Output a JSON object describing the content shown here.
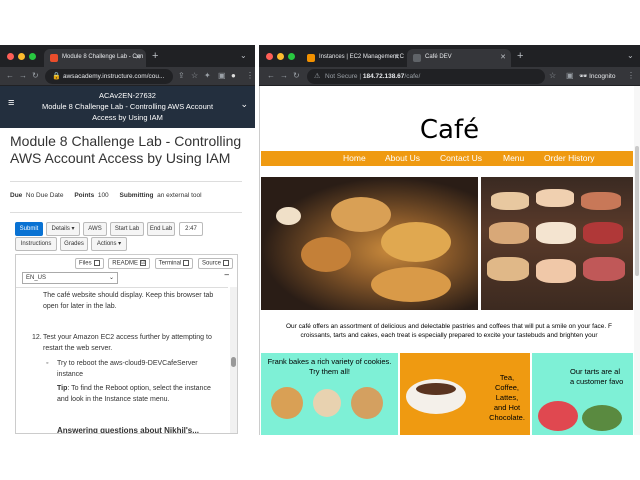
{
  "left_window": {
    "tab_title": "Module 8 Challenge Lab - Con",
    "url": "awsacademy.instructure.com/cou...",
    "header": {
      "course_code": "ACAv2EN-27632",
      "title_line1": "Module 8 Challenge Lab - Controlling AWS Account",
      "title_line2": "Access by Using IAM"
    },
    "page_title": "Module 8 Challenge Lab - Controlling AWS Account Access by Using IAM",
    "meta": {
      "due_label": "Due",
      "due_value": "No Due Date",
      "points_label": "Points",
      "points_value": "100",
      "submitting_label": "Submitting",
      "submitting_value": "an external tool"
    },
    "buttons": {
      "submit": "Submit",
      "details": "Details ▾",
      "aws": "AWS",
      "start_lab": "Start Lab",
      "end_lab": "End Lab",
      "timer": "2:47",
      "instructions": "Instructions",
      "grades": "Grades",
      "actions": "Actions ▾"
    },
    "toggles": {
      "files": "Files",
      "readme": "README",
      "terminal": "Terminal",
      "source": "Source",
      "readme_checked": "☑"
    },
    "language": "EN_US",
    "content": {
      "p1": "The café website should display. Keep this browser tab open for later in the lab.",
      "step_num": "12.",
      "step_text": "Test your Amazon EC2 access further by attempting to restart the web server.",
      "bullet_text": "Try to reboot the aws-cloud9-DEVCafeServer instance",
      "tip_bold": "Tip",
      "tip_text": ": To find the Reboot option, select the instance and look in the Instance state menu.",
      "next_heading": "Answering questions about Nikhil's..."
    }
  },
  "right_window": {
    "tabs": [
      {
        "title": "Instances | EC2 Management C"
      },
      {
        "title": "Café DEV"
      }
    ],
    "not_secure": "Not Secure",
    "url_host": "184.72.138.67",
    "url_path": "/cafe/",
    "incognito": "Incognito",
    "cafe": {
      "title": "Café",
      "menu": [
        "Home",
        "About Us",
        "Contact Us",
        "Menu",
        "Order History"
      ],
      "desc_line1": "Our café offers an assortment of delicious and delectable pastries and coffees that will put a smile on your face. F",
      "desc_line2": "croissants, tarts and cakes, each treat is especially prepared to excite your tastebuds and brighten your",
      "card1": "Frank bakes a rich variety of cookies. Try them all!",
      "card2_l1": "Tea,",
      "card2_l2": "Coffee,",
      "card2_l3": "Lattes,",
      "card2_l4": "and Hot",
      "card2_l5": "Chocolate.",
      "card3_l1": "Our tarts are al",
      "card3_l2": "a customer favo"
    }
  },
  "colors": {
    "menu_orange": "#ef9a11",
    "card_teal": "#7ef0d6",
    "aws_navy": "#232f3e",
    "submit_blue": "#0972d3"
  }
}
